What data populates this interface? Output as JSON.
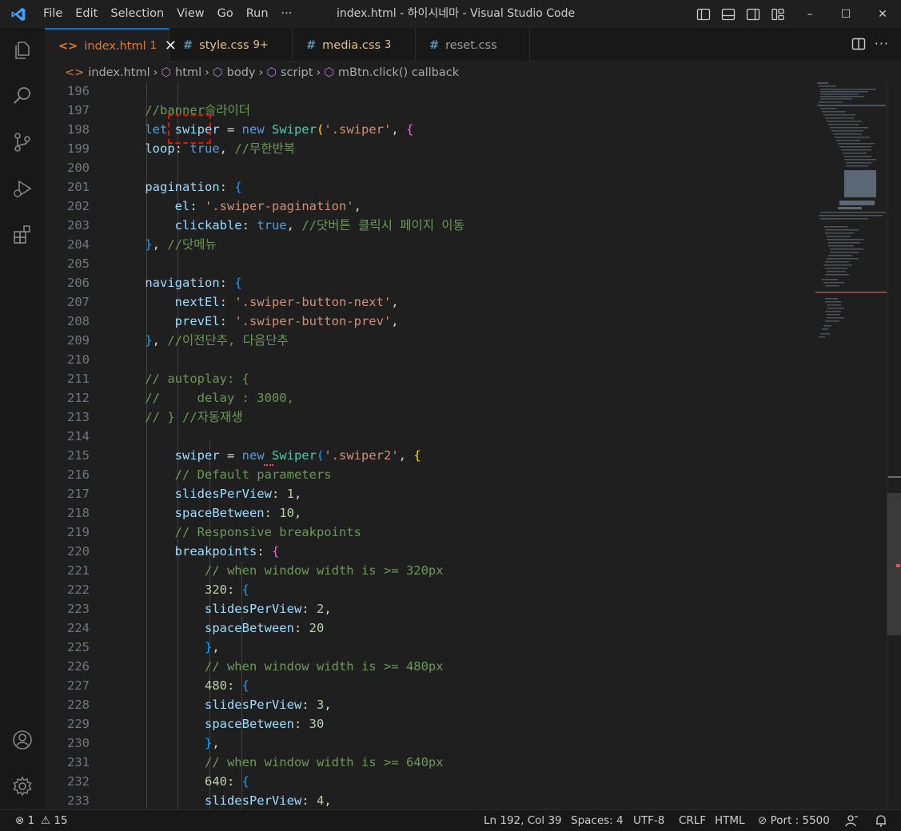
{
  "window": {
    "title": "index.html - 하이시네마 - Visual Studio Code",
    "menu": [
      "File",
      "Edit",
      "Selection",
      "View",
      "Go",
      "Run",
      "···"
    ],
    "controls": {
      "minimize": "–",
      "maximize": "☐",
      "close": "✕"
    }
  },
  "tabs": [
    {
      "icon": "<>",
      "label": "index.html",
      "count": "1",
      "active": true,
      "close": "✕",
      "color": "#e37933"
    },
    {
      "icon": "#",
      "label": "style.css",
      "count": "9+",
      "active": false,
      "color": "#e2c08d"
    },
    {
      "icon": "#",
      "label": "media.css",
      "count": "3",
      "active": false,
      "color": "#e2c08d"
    },
    {
      "icon": "#",
      "label": "reset.css",
      "count": "",
      "active": false,
      "color": "#cccccc"
    }
  ],
  "editor_actions": {
    "more": "···"
  },
  "breadcrumb": [
    {
      "icon": "<>",
      "label": "index.html"
    },
    {
      "icon": "⬡",
      "label": "html"
    },
    {
      "icon": "⬡",
      "label": "body"
    },
    {
      "icon": "⬡",
      "label": "script"
    },
    {
      "icon": "⬡",
      "label": "mBtn.click() callback"
    }
  ],
  "code": {
    "line_numbers": [
      "196",
      "197",
      "198",
      "199",
      "200",
      "201",
      "202",
      "203",
      "204",
      "205",
      "206",
      "207",
      "208",
      "209",
      "210",
      "211",
      "212",
      "213",
      "214",
      "215",
      "216",
      "217",
      "218",
      "219",
      "220",
      "221",
      "222",
      "223",
      "224",
      "225",
      "226",
      "227",
      "228",
      "229",
      "230",
      "231",
      "232",
      "233"
    ],
    "lines": [
      [],
      [
        [
          "c-com",
          "    //banner슬라이더"
        ]
      ],
      [
        [
          "c-kw",
          "    let "
        ],
        [
          "c-var",
          "swiper"
        ],
        [
          "c-op",
          " = "
        ],
        [
          "c-kw",
          "new "
        ],
        [
          "c-cls",
          "Swiper"
        ],
        [
          "c-p1",
          "("
        ],
        [
          "c-str",
          "'.swiper'"
        ],
        [
          "c-op",
          ", "
        ],
        [
          "c-p2",
          "{"
        ]
      ],
      [
        [
          "c-var",
          "    loop"
        ],
        [
          "c-op",
          ": "
        ],
        [
          "c-kw",
          "true"
        ],
        [
          "c-op",
          ", "
        ],
        [
          "c-com",
          "//무한반복"
        ]
      ],
      [],
      [
        [
          "c-var",
          "    pagination"
        ],
        [
          "c-op",
          ": "
        ],
        [
          "c-p3",
          "{"
        ]
      ],
      [
        [
          "c-var",
          "        el"
        ],
        [
          "c-op",
          ": "
        ],
        [
          "c-str",
          "'.swiper-pagination'"
        ],
        [
          "c-op",
          ","
        ]
      ],
      [
        [
          "c-var",
          "        clickable"
        ],
        [
          "c-op",
          ": "
        ],
        [
          "c-kw",
          "true"
        ],
        [
          "c-op",
          ", "
        ],
        [
          "c-com",
          "//닷버튼 클릭시 페이지 이동"
        ]
      ],
      [
        [
          "c-p3",
          "    }"
        ],
        [
          "c-op",
          ", "
        ],
        [
          "c-com",
          "//닷메뉴"
        ]
      ],
      [],
      [
        [
          "c-var",
          "    navigation"
        ],
        [
          "c-op",
          ": "
        ],
        [
          "c-p3",
          "{"
        ]
      ],
      [
        [
          "c-var",
          "        nextEl"
        ],
        [
          "c-op",
          ": "
        ],
        [
          "c-str",
          "'.swiper-button-next'"
        ],
        [
          "c-op",
          ","
        ]
      ],
      [
        [
          "c-var",
          "        prevEl"
        ],
        [
          "c-op",
          ": "
        ],
        [
          "c-str",
          "'.swiper-button-prev'"
        ],
        [
          "c-op",
          ","
        ]
      ],
      [
        [
          "c-p3",
          "    }"
        ],
        [
          "c-op",
          ", "
        ],
        [
          "c-com",
          "//이전단추, 다음단추"
        ]
      ],
      [],
      [
        [
          "c-com",
          "    // autoplay: {"
        ]
      ],
      [
        [
          "c-com",
          "    //     delay : 3000,"
        ]
      ],
      [
        [
          "c-com",
          "    // } //자동재생"
        ]
      ],
      [],
      [
        [
          "c-var",
          "        swiper"
        ],
        [
          "c-op",
          " = "
        ],
        [
          "c-kw",
          "new "
        ],
        [
          "c-cls",
          "Swiper"
        ],
        [
          "c-p3",
          "("
        ],
        [
          "c-str",
          "'.swiper2'"
        ],
        [
          "c-op",
          ", "
        ],
        [
          "c-p1",
          "{"
        ]
      ],
      [
        [
          "c-com",
          "        // Default parameters"
        ]
      ],
      [
        [
          "c-var",
          "        slidesPerView"
        ],
        [
          "c-op",
          ": "
        ],
        [
          "c-num",
          "1"
        ],
        [
          "c-op",
          ","
        ]
      ],
      [
        [
          "c-var",
          "        spaceBetween"
        ],
        [
          "c-op",
          ": "
        ],
        [
          "c-num",
          "10"
        ],
        [
          "c-op",
          ","
        ]
      ],
      [
        [
          "c-com",
          "        // Responsive breakpoints"
        ]
      ],
      [
        [
          "c-var",
          "        breakpoints"
        ],
        [
          "c-op",
          ": "
        ],
        [
          "c-p2",
          "{"
        ]
      ],
      [
        [
          "c-com",
          "            // when window width is >= 320px"
        ]
      ],
      [
        [
          "c-num",
          "            320"
        ],
        [
          "c-op",
          ": "
        ],
        [
          "c-p3",
          "{"
        ]
      ],
      [
        [
          "c-var",
          "            slidesPerView"
        ],
        [
          "c-op",
          ": "
        ],
        [
          "c-num",
          "2"
        ],
        [
          "c-op",
          ","
        ]
      ],
      [
        [
          "c-var",
          "            spaceBetween"
        ],
        [
          "c-op",
          ": "
        ],
        [
          "c-num",
          "20"
        ]
      ],
      [
        [
          "c-p3",
          "            }"
        ],
        [
          "c-op",
          ","
        ]
      ],
      [
        [
          "c-com",
          "            // when window width is >= 480px"
        ]
      ],
      [
        [
          "c-num",
          "            480"
        ],
        [
          "c-op",
          ": "
        ],
        [
          "c-p3",
          "{"
        ]
      ],
      [
        [
          "c-var",
          "            slidesPerView"
        ],
        [
          "c-op",
          ": "
        ],
        [
          "c-num",
          "3"
        ],
        [
          "c-op",
          ","
        ]
      ],
      [
        [
          "c-var",
          "            spaceBetween"
        ],
        [
          "c-op",
          ": "
        ],
        [
          "c-num",
          "30"
        ]
      ],
      [
        [
          "c-p3",
          "            }"
        ],
        [
          "c-op",
          ","
        ]
      ],
      [
        [
          "c-com",
          "            // when window width is >= 640px"
        ]
      ],
      [
        [
          "c-num",
          "            640"
        ],
        [
          "c-op",
          ": "
        ],
        [
          "c-p3",
          "{"
        ]
      ],
      [
        [
          "c-var",
          "            slidesPerView"
        ],
        [
          "c-op",
          ": "
        ],
        [
          "c-num",
          "4"
        ],
        [
          "c-op",
          ","
        ]
      ]
    ]
  },
  "statusbar": {
    "errors": "⊗ 1",
    "warnings": "⚠ 15",
    "cursor": "Ln 192, Col 39",
    "spaces": "Spaces: 4",
    "encoding": "UTF-8",
    "eol": "CRLF",
    "language": "HTML",
    "port": "⊘ Port : 5500"
  }
}
